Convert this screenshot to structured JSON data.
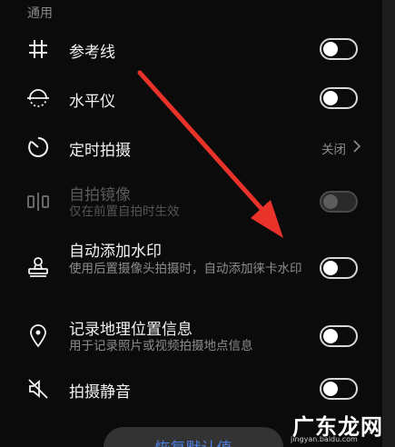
{
  "section": {
    "title": "通用"
  },
  "settings": [
    {
      "title": "参考线",
      "icon": "grid-icon",
      "control": "toggle",
      "on": false,
      "enabled": true
    },
    {
      "title": "水平仪",
      "icon": "level-icon",
      "control": "toggle",
      "on": false,
      "enabled": true
    },
    {
      "title": "定时拍摄",
      "icon": "timer-icon",
      "control": "value",
      "value": "关闭",
      "enabled": true
    },
    {
      "title": "自拍镜像",
      "subtitle": "仅在前置自拍时生效",
      "icon": "mirror-icon",
      "control": "toggle",
      "on": false,
      "enabled": false
    },
    {
      "title": "自动添加水印",
      "subtitle": "使用后置摄像头拍摄时，自动添加徕卡水印",
      "icon": "stamp-icon",
      "control": "toggle",
      "on": false,
      "enabled": true
    },
    {
      "title": "记录地理位置信息",
      "subtitle": "用于记录照片或视频拍摄地点信息",
      "icon": "location-pin-icon",
      "control": "toggle",
      "on": false,
      "enabled": true
    },
    {
      "title": "拍摄静音",
      "icon": "mute-speaker-icon",
      "control": "toggle",
      "on": false,
      "enabled": true
    }
  ],
  "footer": {
    "restore_label": "恢复默认值"
  },
  "watermark": {
    "logo_text": "广东龙网",
    "url": "jingyan.baidu.com"
  },
  "colors": {
    "background": "#0b0b0b",
    "accent_text": "#4a7fe0",
    "arrow": "#e8322a"
  }
}
